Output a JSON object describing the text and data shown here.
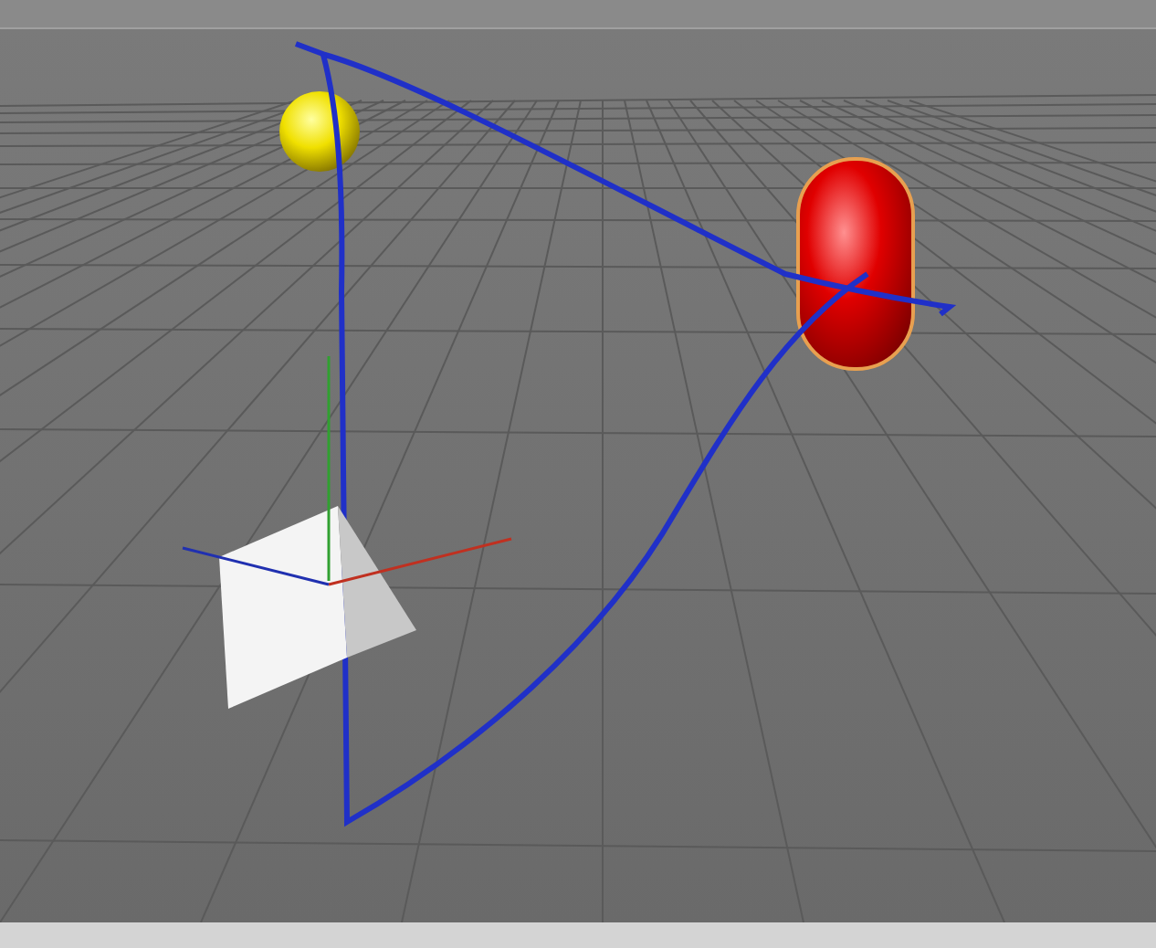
{
  "viewport": {
    "objects": [
      {
        "kind": "sphere",
        "selected": false
      },
      {
        "kind": "capsule",
        "selected": true
      },
      {
        "kind": "spline",
        "selected": false
      },
      {
        "kind": "pyramid",
        "selected": false
      },
      {
        "kind": "axes",
        "selected": false
      }
    ]
  }
}
